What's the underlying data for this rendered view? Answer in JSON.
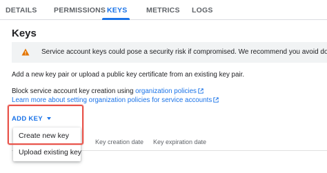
{
  "tabs": {
    "details": "DETAILS",
    "permissions": "PERMISSIONS",
    "keys": "KEYS",
    "metrics": "METRICS",
    "logs": "LOGS"
  },
  "page": {
    "title": "Keys"
  },
  "warning": {
    "icon": "warning-triangle-icon",
    "text": "Service account keys could pose a security risk if compromised. We recommend you avoid downloading service a"
  },
  "info": {
    "add_key_text": "Add a new key pair or upload a public key certificate from an existing key pair.",
    "block_prefix": "Block service account key creation using ",
    "block_link": "organization policies",
    "learn_link": "Learn more about setting organization policies for service accounts"
  },
  "toolbar": {
    "add_key_label": "ADD KEY"
  },
  "table": {
    "columns": [
      "Key creation date",
      "Key expiration date"
    ]
  },
  "menu": {
    "items": [
      "Create new key",
      "Upload existing key"
    ]
  },
  "colors": {
    "accent": "#1a73e8",
    "warning": "#e37400",
    "highlight": "#e8534a"
  }
}
